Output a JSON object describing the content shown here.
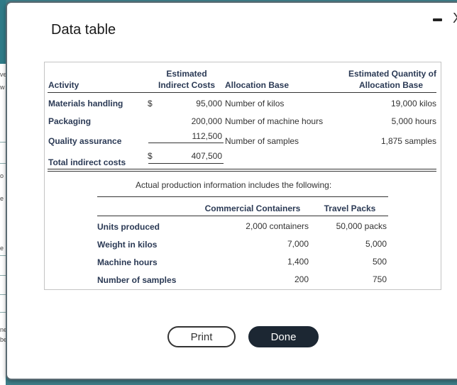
{
  "dialog": {
    "title": "Data table",
    "minimize_label": "–",
    "close_label": "X"
  },
  "table1": {
    "headers": {
      "activity": "Activity",
      "costs_line1": "Estimated",
      "costs_line2": "Indirect Costs",
      "allocation_base": "Allocation Base",
      "qty_line1": "Estimated Quantity of",
      "qty_line2": "Allocation Base"
    },
    "rows": [
      {
        "activity": "Materials handling",
        "dollar": "$",
        "cost": "95,000",
        "base": "Number of kilos",
        "qty": "19,000 kilos"
      },
      {
        "activity": "Packaging",
        "dollar": "",
        "cost": "200,000",
        "base": "Number of machine hours",
        "qty": "5,000 hours"
      },
      {
        "activity": "Quality assurance",
        "dollar": "",
        "cost": "112,500",
        "base": "Number of samples",
        "qty": "1,875 samples"
      }
    ],
    "total": {
      "activity": "Total indirect costs",
      "dollar": "$",
      "cost": "407,500"
    }
  },
  "actual_note": "Actual production information includes the following:",
  "table2": {
    "headers": {
      "col1": "Commercial Containers",
      "col2": "Travel Packs"
    },
    "rows": [
      {
        "label": "Units produced",
        "c1": "2,000 containers",
        "c2": "50,000 packs"
      },
      {
        "label": "Weight in kilos",
        "c1": "7,000",
        "c2": "5,000"
      },
      {
        "label": "Machine hours",
        "c1": "1,400",
        "c2": "500"
      },
      {
        "label": "Number of samples",
        "c1": "200",
        "c2": "750"
      }
    ]
  },
  "buttons": {
    "print": "Print",
    "done": "Done"
  },
  "background_fragments": [
    "ve",
    "w",
    "o",
    "e",
    "e",
    "ne",
    "be"
  ]
}
